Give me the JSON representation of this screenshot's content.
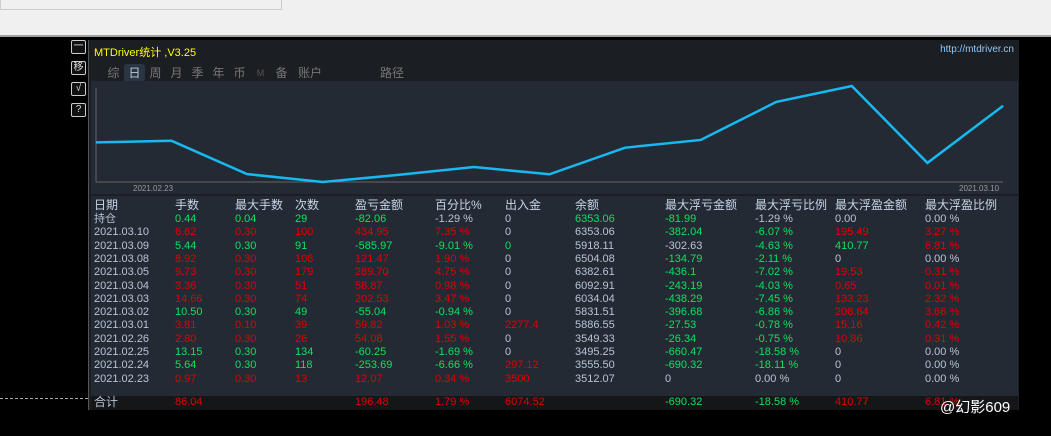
{
  "panel": {
    "title": "MTDriver统计 ,V3.25",
    "url": "http://mtdriver.cn"
  },
  "side_buttons": [
    "一",
    "移",
    "√",
    "?"
  ],
  "tabs": [
    {
      "label": "综"
    },
    {
      "label": "日",
      "active": true
    },
    {
      "label": "周"
    },
    {
      "label": "月"
    },
    {
      "label": "季"
    },
    {
      "label": "年"
    },
    {
      "label": "币"
    },
    {
      "label": "M"
    },
    {
      "label": "备"
    },
    {
      "label": "账户"
    },
    {
      "label": "路径"
    }
  ],
  "chart_data": {
    "type": "line",
    "x_start_label": "2021.02.23",
    "x_end_label": "2021.03.10",
    "series": [
      {
        "name": "cumulative profit",
        "values": [
          0,
          12.07,
          -241.62,
          -301.87,
          -247.79,
          -187.97,
          -243.01,
          -40.48,
          18.39,
          308.09,
          429.56,
          -156.41,
          278.54
        ]
      }
    ],
    "color": "#18b8f0"
  },
  "table": {
    "headers": [
      "日期",
      "手数",
      "最大手数",
      "次数",
      "盈亏金额",
      "百分比%",
      "出入金",
      "余额",
      "最大浮亏金额",
      "最大浮亏比例",
      "最大浮盈金额",
      "最大浮盈比例"
    ],
    "rows": [
      {
        "c": [
          "持仓",
          "0.44",
          "0.04",
          "29",
          "-82.06",
          "-1.29 %",
          "0",
          "6353.06",
          "-81.99",
          "-1.29 %",
          "0.00",
          "0.00 %"
        ],
        "k": "nggggnngg nn"
      },
      {
        "c": [
          "2021.03.10",
          "6.62",
          "0.30",
          "100",
          "434.95",
          "7.35 %",
          "0",
          "6353.06",
          "-382.04",
          "-6.07 %",
          "195.49",
          "3.27 %"
        ],
        "k": "nrrrrrnnggrr"
      },
      {
        "c": [
          "2021.03.09",
          "5.44",
          "0.30",
          "91",
          "-585.97",
          "-9.01 %",
          "0",
          "5918.11",
          "-302.63",
          "-4.63 %",
          "410.77",
          "6.81 %"
        ],
        "k": "nggggggnnggrr"
      },
      {
        "c": [
          "2021.03.08",
          "8.92",
          "0.30",
          "108",
          "121.47",
          "1.90 %",
          "0",
          "6504.08",
          "-134.79",
          "-2.11 %",
          "0",
          "0.00 %"
        ],
        "k": "nrrrrrnnggnn"
      },
      {
        "c": [
          "2021.03.05",
          "9.73",
          "0.30",
          "179",
          "289.70",
          "4.75 %",
          "0",
          "6382.61",
          "-436.1",
          "-7.02 %",
          "19.53",
          "0.31 %"
        ],
        "k": "nrrrrrnnggrr"
      },
      {
        "c": [
          "2021.03.04",
          "3.36",
          "0.30",
          "51",
          "58.87",
          "0.98 %",
          "0",
          "6092.91",
          "-243.19",
          "-4.03 %",
          "0.65",
          "0.01 %"
        ],
        "k": "nrrrrrnnggrr"
      },
      {
        "c": [
          "2021.03.03",
          "14.66",
          "0.30",
          "74",
          "202.53",
          "3.47 %",
          "0",
          "6034.04",
          "-438.29",
          "-7.45 %",
          "133.23",
          "2.32 %"
        ],
        "k": "nrrrrrnnggrr"
      },
      {
        "c": [
          "2021.03.02",
          "10.50",
          "0.30",
          "49",
          "-55.04",
          "-0.94 %",
          "0",
          "5831.51",
          "-396.68",
          "-6.86 %",
          "208.64",
          "3.66 %"
        ],
        "k": "nggggg nnggrr"
      },
      {
        "c": [
          "2021.03.01",
          "3.81",
          "0.10",
          "39",
          "59.82",
          "1.03 %",
          "2277.4",
          "5886.55",
          "-27.53",
          "-0.78 %",
          "15.16",
          "0.42 %"
        ],
        "k": "nrrrrrrnggrr"
      },
      {
        "c": [
          "2021.02.26",
          "2.80",
          "0.30",
          "26",
          "54.08",
          "1.55 %",
          "0",
          "3549.33",
          "-26.34",
          "-0.75 %",
          "10.86",
          "0.31 %"
        ],
        "k": "nrrrrrnnggrr"
      },
      {
        "c": [
          "2021.02.25",
          "13.15",
          "0.30",
          "134",
          "-60.25",
          "-1.69 %",
          "0",
          "3495.25",
          "-660.47",
          "-18.58 %",
          "0",
          "0.00 %"
        ],
        "k": "ngggggnnggnn"
      },
      {
        "c": [
          "2021.02.24",
          "5.64",
          "0.30",
          "118",
          "-253.69",
          "-6.66 %",
          "297.12",
          "3555.50",
          "-690.32",
          "-18.11 %",
          "0",
          "0.00 %"
        ],
        "k": "ngggggrnggnn"
      },
      {
        "c": [
          "2021.02.23",
          "0.97",
          "0.30",
          "13",
          "12.07",
          "0.34 %",
          "3500",
          "3512.07",
          "0",
          "0.00 %",
          "0",
          "0.00 %"
        ],
        "k": "nrrrrrrnnnnn"
      }
    ],
    "total": {
      "c": [
        "合计",
        "86.04",
        "",
        "",
        "196.48",
        "1.79 %",
        "6074.52",
        "",
        "-690.32",
        "-18.58 %",
        "410.77",
        "6.81 %"
      ],
      "k": "nrrrrrrnggrr"
    }
  },
  "watermark": "@幻影609"
}
